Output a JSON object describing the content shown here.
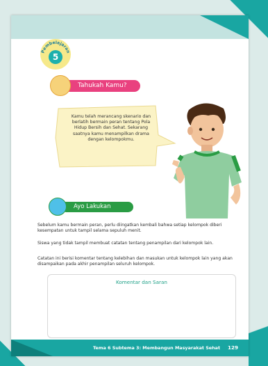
{
  "colors": {
    "teal": "#19a6a2",
    "pink": "#e9417f",
    "green": "#2a9c44",
    "speech_bg": "#fbf3c6"
  },
  "badge": {
    "arc_text": "Pembelajaran",
    "number": "5"
  },
  "tahukah": {
    "label": "Tahukah Kamu?"
  },
  "speech": {
    "text": "Kamu telah merancang skenario dan berlatih bermain peran tentang Pola Hidup Bersih dan Sehat. Sekarang saatnya kamu menampilkan drama dengan kelompokmu."
  },
  "ayo": {
    "label": "Ayo Lakukan"
  },
  "paragraphs": [
    "Sebelum kamu bermain peran, perlu diingatkan kembali bahwa setiap kelompok diberi kesempatan untuk tampil selama sepuluh menit.",
    "Siswa yang tidak tampil membuat catatan tentang penampilan dari kelompok lain.",
    "Catatan ini berisi komentar tentang kelebihan dan masukan untuk kelompok lain yang akan disampaikan pada akhir penampilan seluruh kelompok."
  ],
  "comment_box": {
    "title": "Komentar dan Saran"
  },
  "footer": {
    "text": "Tema 6 Subtema 3: Membangun Masyarakat Sehat",
    "page": "129"
  }
}
